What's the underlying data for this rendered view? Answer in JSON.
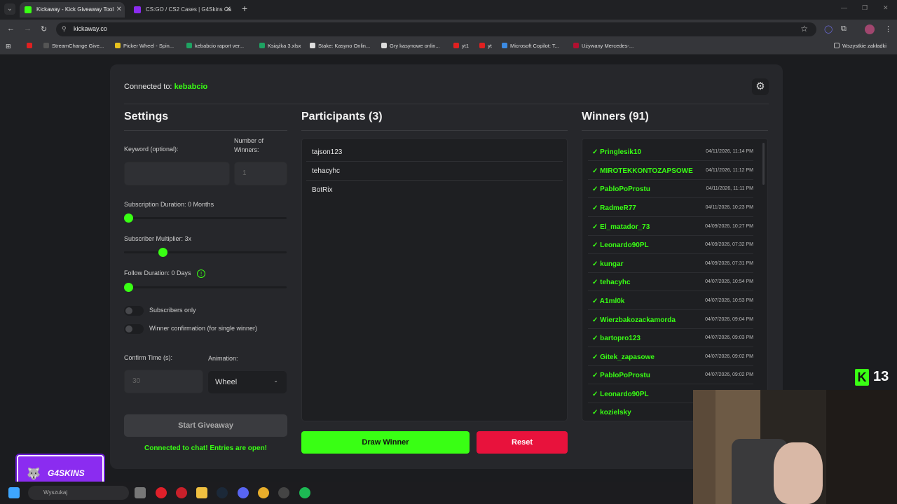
{
  "browser": {
    "tabs": [
      {
        "title": "Kickaway - Kick Giveaway Tool",
        "active": true
      },
      {
        "title": "CS:GO / CS2 Cases | G4Skins Ca",
        "active": false
      }
    ],
    "url": "kickaway.co",
    "bookmarks": [
      "StreamChange Give...",
      "Picker Wheel - Spin...",
      "kebabcio raport ver...",
      "Książka 3.xlsx",
      "Stake: Kasyno Onlin...",
      "Gry kasynowe onlin...",
      "yt1",
      "yt",
      "Microsoft Copilot: T...",
      "Używany Mercedes-..."
    ],
    "bookmarks_folder": "Wszystkie zakładki"
  },
  "header": {
    "connected_label": "Connected to:",
    "channel": "kebabcio"
  },
  "settings": {
    "title": "Settings",
    "keyword_label": "Keyword (optional):",
    "keyword_value": "",
    "winners_label": "Number of Winners:",
    "winners_placeholder": "1",
    "sub_duration_label": "Subscription Duration: 0 Months",
    "sub_duration_value": 0,
    "sub_multiplier_label": "Subscriber Multiplier: 3x",
    "sub_multiplier_value": 3,
    "follow_duration_label": "Follow Duration:  0  Days",
    "follow_duration_value": 0,
    "subscribers_only_label": "Subscribers only",
    "winner_confirmation_label": "Winner confirmation (for single winner)",
    "confirm_time_label": "Confirm Time (s):",
    "confirm_time_placeholder": "30",
    "animation_label": "Animation:",
    "animation_value": "Wheel",
    "start_button": "Start Giveaway",
    "chat_status": "Connected to chat! Entries are open!"
  },
  "participants": {
    "title": "Participants (3)",
    "items": [
      "tajson123",
      "tehacyhc",
      "BotRix"
    ],
    "draw_button": "Draw Winner",
    "reset_button": "Reset"
  },
  "winners": {
    "title": "Winners (91)",
    "items": [
      {
        "name": "✓ Pringlesik10",
        "date": "04/11/2026, 11:14 PM"
      },
      {
        "name": "✓ MIROTEKKONTOZAPSOWE",
        "date": "04/11/2026, 11:12 PM"
      },
      {
        "name": "✓ PabloPoProstu",
        "date": "04/11/2026, 11:11 PM"
      },
      {
        "name": "✓ RadmeR77",
        "date": "04/11/2026, 10:23 PM"
      },
      {
        "name": "✓ El_matador_73",
        "date": "04/09/2026, 10:27 PM"
      },
      {
        "name": "✓ Leonardo90PL",
        "date": "04/09/2026, 07:32 PM"
      },
      {
        "name": "✓ kungar",
        "date": "04/09/2026, 07:31 PM"
      },
      {
        "name": "✓ tehacyhc",
        "date": "04/07/2026, 10:54 PM"
      },
      {
        "name": "✓ A1ml0k",
        "date": "04/07/2026, 10:53 PM"
      },
      {
        "name": "✓ Wierzbakozackamorda",
        "date": "04/07/2026, 09:04 PM"
      },
      {
        "name": "✓ bartopro123",
        "date": "04/07/2026, 09:03 PM"
      },
      {
        "name": "✓ Gitek_zapasowe",
        "date": "04/07/2026, 09:02 PM"
      },
      {
        "name": "✓ PabloPoProstu",
        "date": "04/07/2026, 09:02 PM"
      },
      {
        "name": "✓ Leonardo90PL",
        "date": ""
      },
      {
        "name": "✓ kozielsky",
        "date": ""
      }
    ]
  },
  "overlay": {
    "kick_count": "13",
    "sponsor_logo": "G4SKINS"
  },
  "taskbar": {
    "search_placeholder": "Wyszukaj"
  },
  "colors": {
    "accent": "#39ff14",
    "danger": "#e8123c",
    "panel": "#26272b"
  }
}
